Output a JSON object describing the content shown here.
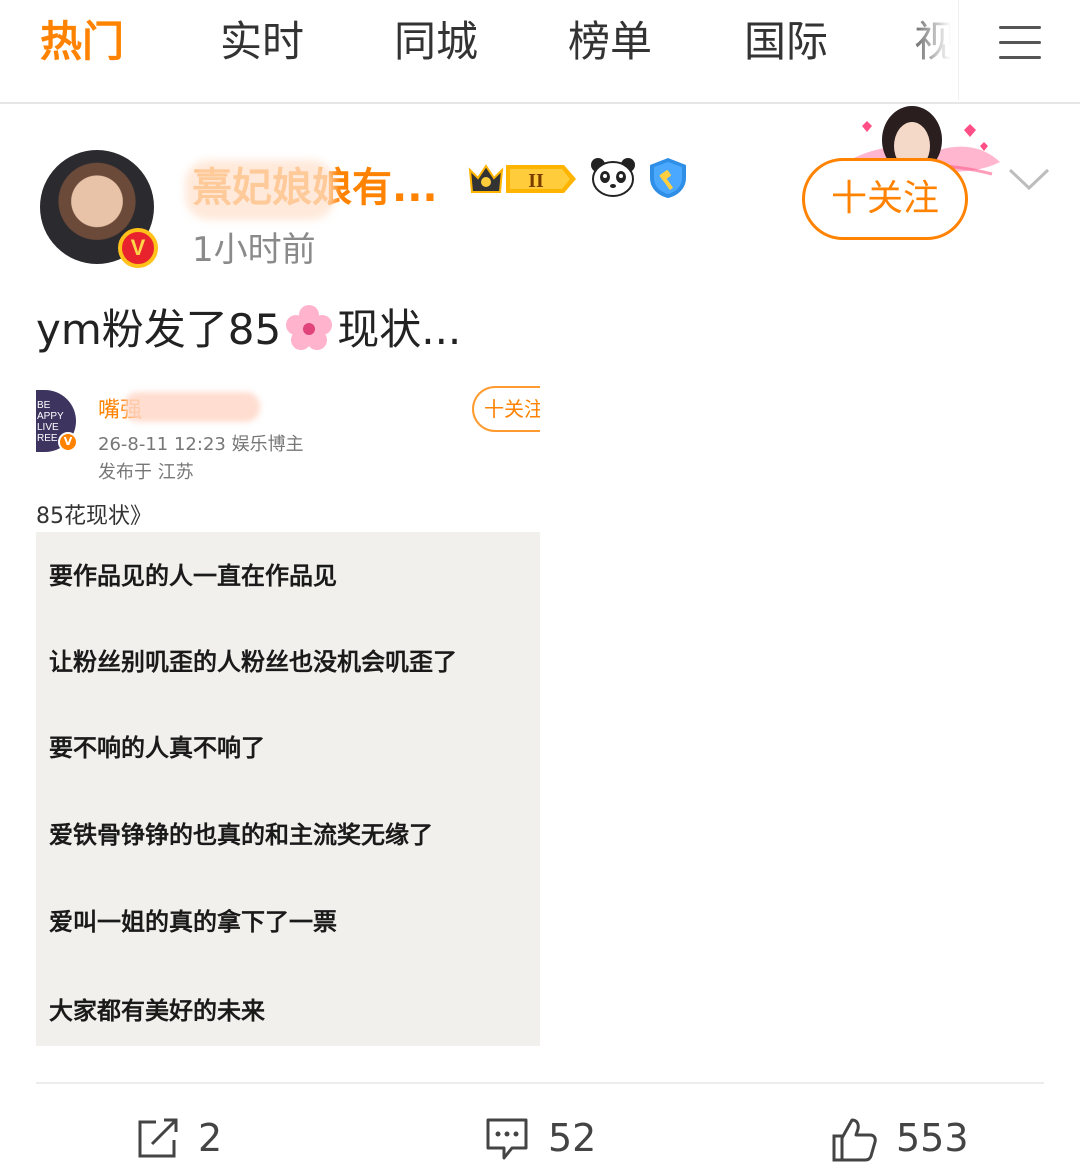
{
  "tabs": [
    {
      "label": "热门",
      "active": true
    },
    {
      "label": "实时",
      "active": false
    },
    {
      "label": "同城",
      "active": false
    },
    {
      "label": "榜单",
      "active": false
    },
    {
      "label": "国际",
      "active": false
    },
    {
      "label": "视",
      "active": false
    }
  ],
  "post": {
    "username": "熹妃娘娘有...",
    "member_badge": "II",
    "time": "1小时前",
    "follow_label": "十关注",
    "text_before": "ym粉发了85",
    "text_after": "现状..."
  },
  "embedded": {
    "avatar_lines": [
      "BE",
      "APPY",
      "LIVE",
      "REE"
    ],
    "username": "嘴强",
    "follow_label": "十关注",
    "meta": "26-8-11 12:23  娱乐博主",
    "location": "发布于 江苏",
    "caption": "85花现状》",
    "lines": [
      "要作品见的人一直在作品见",
      "让粉丝别叽歪的人粉丝也没机会叽歪了",
      "要不响的人真不响了",
      "爱铁骨铮铮的也真的和主流奖无缘了",
      "爱叫一姐的真的拿下了一票",
      "大家都有美好的未来"
    ]
  },
  "actions": {
    "share_count": "2",
    "comment_count": "52",
    "like_count": "553"
  },
  "colors": {
    "accent": "#ff8200",
    "text": "#222222",
    "muted": "#8a8a8a"
  },
  "icons": [
    "menu-icon",
    "verified-badge-icon",
    "crown-member-badge-icon",
    "panda-icon",
    "shield-badge-icon",
    "chevron-down-icon",
    "flower-emoji-icon",
    "share-icon",
    "comment-icon",
    "like-icon"
  ]
}
